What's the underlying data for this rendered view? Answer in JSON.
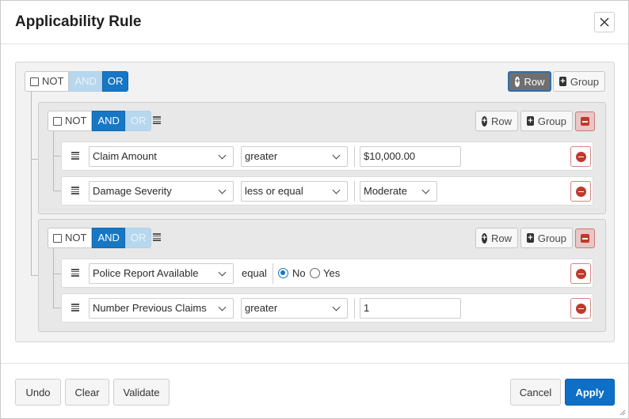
{
  "dialog": {
    "title": "Applicability Rule",
    "close_icon": "close-icon"
  },
  "root_group": {
    "not_label": "NOT",
    "and_label": "AND",
    "or_label": "OR",
    "conjunction": "OR",
    "add_row_label": "Row",
    "add_group_label": "Group"
  },
  "groups": [
    {
      "not_label": "NOT",
      "and_label": "AND",
      "or_label": "OR",
      "conjunction": "AND",
      "add_row_label": "Row",
      "add_group_label": "Group",
      "rules": [
        {
          "field": "Claim Amount",
          "operator": "greater",
          "value": "$10,000.00"
        },
        {
          "field": "Damage Severity",
          "operator": "less or equal",
          "value": "Moderate"
        }
      ]
    },
    {
      "not_label": "NOT",
      "and_label": "AND",
      "or_label": "OR",
      "conjunction": "AND",
      "add_row_label": "Row",
      "add_group_label": "Group",
      "rules": [
        {
          "field": "Police Report Available",
          "operator": "equal",
          "value": "No",
          "options": [
            "No",
            "Yes"
          ]
        },
        {
          "field": "Number Previous Claims",
          "operator": "greater",
          "value": "1"
        }
      ]
    }
  ],
  "footer": {
    "undo_label": "Undo",
    "clear_label": "Clear",
    "validate_label": "Validate",
    "cancel_label": "Cancel",
    "apply_label": "Apply"
  },
  "colors": {
    "accent": "#1677c5",
    "primary_button": "#0e6fc7",
    "danger": "#c0392b"
  }
}
